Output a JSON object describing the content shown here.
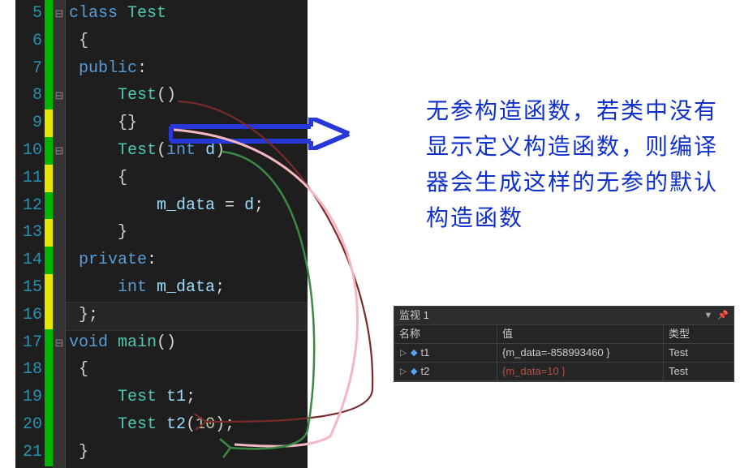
{
  "editor": {
    "line_numbers": [
      "5",
      "6",
      "7",
      "8",
      "9",
      "10",
      "11",
      "12",
      "13",
      "14",
      "15",
      "16",
      "17",
      "18",
      "19",
      "20",
      "21"
    ],
    "markers": [
      "g",
      "g",
      "g",
      "g",
      "y",
      "g",
      "y",
      "g",
      "y",
      "g",
      "y",
      "y",
      "g",
      "g",
      "g",
      "g",
      "g"
    ],
    "fold": [
      "box",
      "",
      "",
      "box",
      "",
      "box",
      "",
      "",
      "",
      "",
      "",
      "",
      "box",
      "",
      "",
      "",
      ""
    ],
    "lines": {
      "l0": {
        "indent": "",
        "t": [
          [
            "kw",
            "class "
          ],
          [
            "type",
            "Test"
          ]
        ]
      },
      "l1": {
        "indent": " ",
        "t": [
          [
            "brace",
            "{"
          ]
        ]
      },
      "l2": {
        "indent": " ",
        "t": [
          [
            "kw",
            "public"
          ],
          [
            "plain",
            ":"
          ]
        ]
      },
      "l3": {
        "indent": "     ",
        "t": [
          [
            "type",
            "Test"
          ],
          [
            "plain",
            "()"
          ]
        ]
      },
      "l4": {
        "indent": "     ",
        "t": [
          [
            "brace",
            "{}"
          ]
        ]
      },
      "l5": {
        "indent": "     ",
        "t": [
          [
            "type",
            "Test"
          ],
          [
            "plain",
            "("
          ],
          [
            "kw",
            "int"
          ],
          [
            "plain",
            " "
          ],
          [
            "var",
            "d"
          ],
          [
            "plain",
            ")"
          ]
        ]
      },
      "l6": {
        "indent": "     ",
        "t": [
          [
            "brace",
            "{"
          ]
        ]
      },
      "l7": {
        "indent": "         ",
        "t": [
          [
            "var",
            "m_data"
          ],
          [
            "plain",
            " = "
          ],
          [
            "var",
            "d"
          ],
          [
            "plain",
            ";"
          ]
        ]
      },
      "l8": {
        "indent": "     ",
        "t": [
          [
            "brace",
            "}"
          ]
        ]
      },
      "l9": {
        "indent": " ",
        "t": [
          [
            "kw",
            "private"
          ],
          [
            "plain",
            ":"
          ]
        ]
      },
      "l10": {
        "indent": "     ",
        "t": [
          [
            "kw",
            "int"
          ],
          [
            "plain",
            " "
          ],
          [
            "var",
            "m_data"
          ],
          [
            "plain",
            ";"
          ]
        ]
      },
      "l11": {
        "indent": " ",
        "t": [
          [
            "brace",
            "};"
          ]
        ]
      },
      "l12": {
        "indent": "",
        "t": [
          [
            "kw",
            "void"
          ],
          [
            "plain",
            " "
          ],
          [
            "type",
            "main"
          ],
          [
            "plain",
            "()"
          ]
        ]
      },
      "l13": {
        "indent": " ",
        "t": [
          [
            "brace",
            "{"
          ]
        ]
      },
      "l14": {
        "indent": "     ",
        "t": [
          [
            "type",
            "Test"
          ],
          [
            "plain",
            " "
          ],
          [
            "var",
            "t1"
          ],
          [
            "plain",
            ";"
          ]
        ]
      },
      "l15": {
        "indent": "     ",
        "t": [
          [
            "type",
            "Test"
          ],
          [
            "plain",
            " "
          ],
          [
            "var",
            "t2"
          ],
          [
            "plain",
            "("
          ],
          [
            "num",
            "10"
          ],
          [
            "plain",
            ");"
          ]
        ]
      },
      "l16": {
        "indent": " ",
        "t": [
          [
            "brace",
            "}"
          ]
        ]
      }
    }
  },
  "annotation": {
    "text": "无参构造函数，若类中没有显示定义构造函数，则编译器会生成这样的无参的默认构造函数"
  },
  "watch": {
    "title": "监视 1",
    "columns": {
      "name": "名称",
      "value": "值",
      "type": "类型"
    },
    "rows": [
      {
        "name": "t1",
        "value": "{m_data=-858993460 }",
        "type": "Test",
        "red": false
      },
      {
        "name": "t2",
        "value": "{m_data=10 }",
        "type": "Test",
        "red": true
      }
    ]
  }
}
